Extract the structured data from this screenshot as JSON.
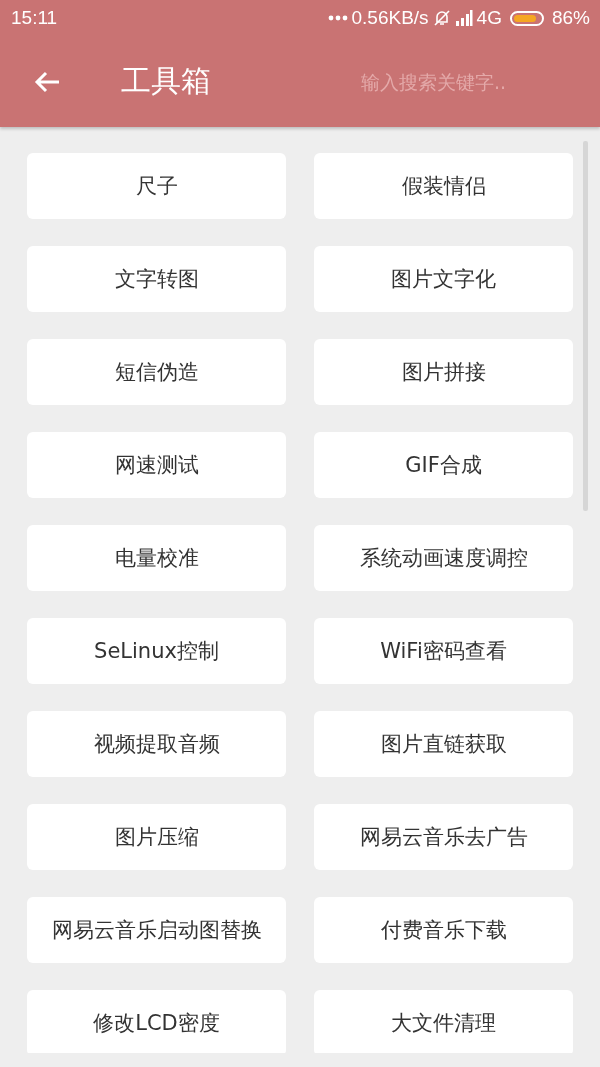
{
  "status_bar": {
    "time": "15:11",
    "network_speed": "0.56KB/s",
    "network_type": "4G",
    "battery": "86%"
  },
  "toolbar": {
    "title": "工具箱",
    "search": {
      "placeholder": "输入搜索关键字.."
    }
  },
  "tools": [
    {
      "label": "尺子"
    },
    {
      "label": "假装情侣"
    },
    {
      "label": "文字转图"
    },
    {
      "label": "图片文字化"
    },
    {
      "label": "短信伪造"
    },
    {
      "label": "图片拼接"
    },
    {
      "label": "网速测试"
    },
    {
      "label": "GIF合成"
    },
    {
      "label": "电量校准"
    },
    {
      "label": "系统动画速度调控"
    },
    {
      "label": "SeLinux控制"
    },
    {
      "label": "WiFi密码查看"
    },
    {
      "label": "视频提取音频"
    },
    {
      "label": "图片直链获取"
    },
    {
      "label": "图片压缩"
    },
    {
      "label": "网易云音乐去广告"
    },
    {
      "label": "网易云音乐启动图替换"
    },
    {
      "label": "付费音乐下载"
    },
    {
      "label": "修改LCD密度"
    },
    {
      "label": "大文件清理"
    }
  ]
}
